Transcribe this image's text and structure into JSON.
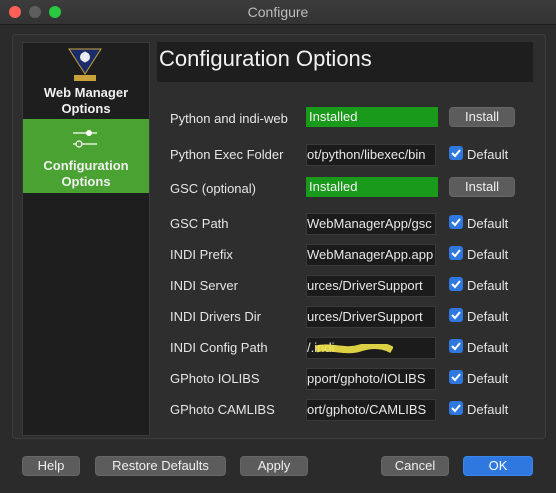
{
  "window": {
    "title": "Configure"
  },
  "sidebar": {
    "items": [
      {
        "label_line1": "Web Manager",
        "label_line2": "Options"
      },
      {
        "label_line1": "Configuration",
        "label_line2": "Options"
      }
    ],
    "logo_text": "INDI"
  },
  "main": {
    "heading": "Configuration Options"
  },
  "rows": [
    {
      "label": "Python and indi-web",
      "status": "Installed",
      "button": "Install"
    },
    {
      "label": "Python Exec Folder",
      "value": "ot/python/libexec/bin",
      "check": "Default"
    },
    {
      "label": "GSC (optional)",
      "status": "Installed",
      "button": "Install"
    },
    {
      "label": "GSC Path",
      "value": "WebManagerApp/gsc",
      "check": "Default"
    },
    {
      "label": "INDI Prefix",
      "value": "WebManagerApp.app",
      "check": "Default"
    },
    {
      "label": "INDI Server",
      "value": "urces/DriverSupport",
      "check": "Default"
    },
    {
      "label": "INDI Drivers Dir",
      "value": "urces/DriverSupport",
      "check": "Default"
    },
    {
      "label": "INDI Config Path",
      "value": "/.indi",
      "check": "Default"
    },
    {
      "label": "GPhoto IOLIBS",
      "value": "pport/gphoto/IOLIBS",
      "check": "Default"
    },
    {
      "label": "GPhoto CAMLIBS",
      "value": "ort/gphoto/CAMLIBS",
      "check": "Default"
    }
  ],
  "footer": {
    "help": "Help",
    "restore": "Restore Defaults",
    "apply": "Apply",
    "cancel": "Cancel",
    "ok": "OK"
  },
  "colors": {
    "accent": "#2f78e0",
    "sidebar_selected": "#4aa232",
    "installed": "#1a9a1a"
  }
}
